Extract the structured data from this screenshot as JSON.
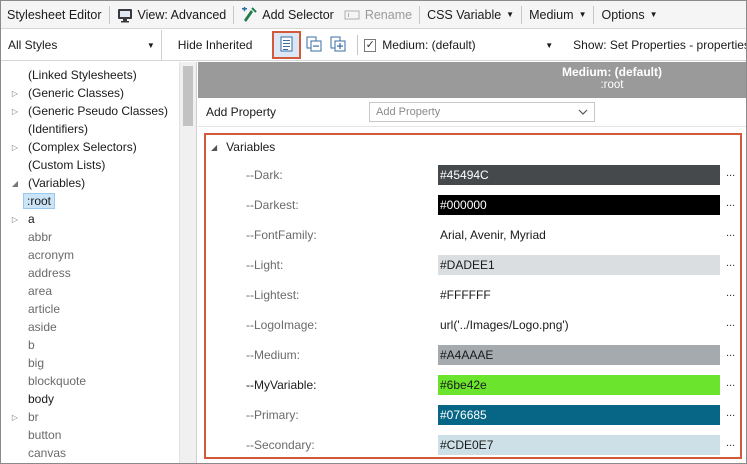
{
  "toolbar": {
    "title": "Stylesheet Editor",
    "view": "View: Advanced",
    "add_selector": "Add Selector",
    "rename": "Rename",
    "css_variable": "CSS Variable",
    "medium": "Medium",
    "options": "Options"
  },
  "toolbar2": {
    "styles_filter": "All Styles",
    "hide_inherited": "Hide Inherited",
    "medium_label": "Medium: (default)",
    "show_label": "Show: Set Properties - properties s"
  },
  "tree": {
    "items": [
      {
        "label": "(Linked Stylesheets)",
        "expander": "",
        "style": "dark"
      },
      {
        "label": "(Generic Classes)",
        "expander": "▷",
        "style": "dark"
      },
      {
        "label": "(Generic Pseudo Classes)",
        "expander": "▷",
        "style": "dark"
      },
      {
        "label": "(Identifiers)",
        "expander": "",
        "style": "dark"
      },
      {
        "label": "(Complex Selectors)",
        "expander": "▷",
        "style": "dark"
      },
      {
        "label": "(Custom Lists)",
        "expander": "",
        "style": "dark"
      },
      {
        "label": "(Variables)",
        "expander": "◢",
        "style": "dark"
      },
      {
        "label": ":root",
        "expander": "",
        "style": "selected"
      },
      {
        "label": "a",
        "expander": "▷",
        "style": "dark"
      },
      {
        "label": "abbr",
        "expander": "",
        "style": "gray"
      },
      {
        "label": "acronym",
        "expander": "",
        "style": "gray"
      },
      {
        "label": "address",
        "expander": "",
        "style": "gray"
      },
      {
        "label": "area",
        "expander": "",
        "style": "gray"
      },
      {
        "label": "article",
        "expander": "",
        "style": "gray"
      },
      {
        "label": "aside",
        "expander": "",
        "style": "gray"
      },
      {
        "label": "b",
        "expander": "",
        "style": "gray"
      },
      {
        "label": "big",
        "expander": "",
        "style": "gray"
      },
      {
        "label": "blockquote",
        "expander": "",
        "style": "gray"
      },
      {
        "label": "body",
        "expander": "",
        "style": "dark"
      },
      {
        "label": "br",
        "expander": "▷",
        "style": "gray"
      },
      {
        "label": "button",
        "expander": "",
        "style": "gray"
      },
      {
        "label": "canvas",
        "expander": "",
        "style": "gray"
      }
    ]
  },
  "panel": {
    "header_title": "Medium: (default)",
    "header_sub": ":root",
    "add_property_label": "Add Property",
    "add_property_placeholder": "Add Property",
    "variables_label": "Variables"
  },
  "variables": [
    {
      "name": "--Dark:",
      "value": "#45494C",
      "bg": "#45494C",
      "fg": "#ffffff",
      "name_dark": false
    },
    {
      "name": "--Darkest:",
      "value": "#000000",
      "bg": "#000000",
      "fg": "#ffffff",
      "name_dark": false
    },
    {
      "name": "--FontFamily:",
      "value": "Arial, Avenir, Myriad",
      "bg": "",
      "fg": "#1a1a1a",
      "name_dark": false
    },
    {
      "name": "--Light:",
      "value": "#DADEE1",
      "bg": "#DADEE1",
      "fg": "#1a1a1a",
      "name_dark": false
    },
    {
      "name": "--Lightest:",
      "value": "#FFFFFF",
      "bg": "#FFFFFF",
      "fg": "#1a1a1a",
      "name_dark": false
    },
    {
      "name": "--LogoImage:",
      "value": "url('../Images/Logo.png')",
      "bg": "",
      "fg": "#1a1a1a",
      "name_dark": false
    },
    {
      "name": "--Medium:",
      "value": "#A4AAAE",
      "bg": "#A4AAAE",
      "fg": "#1a1a1a",
      "name_dark": false
    },
    {
      "name": "--MyVariable:",
      "value": "#6be42e",
      "bg": "#6be42e",
      "fg": "#1a1a1a",
      "name_dark": true
    },
    {
      "name": "--Primary:",
      "value": "#076685",
      "bg": "#076685",
      "fg": "#ffffff",
      "name_dark": false
    },
    {
      "name": "--Secondary:",
      "value": "#CDE0E7",
      "bg": "#CDE0E7",
      "fg": "#1a1a1a",
      "name_dark": false
    }
  ],
  "more_glyph": "...",
  "icons": {
    "view": "monitor-icon",
    "add_selector": "add-selector-icon",
    "rename": "rename-icon",
    "set_properties": "properties-list-icon",
    "collapse": "collapse-icon",
    "expand": "expand-icon"
  }
}
